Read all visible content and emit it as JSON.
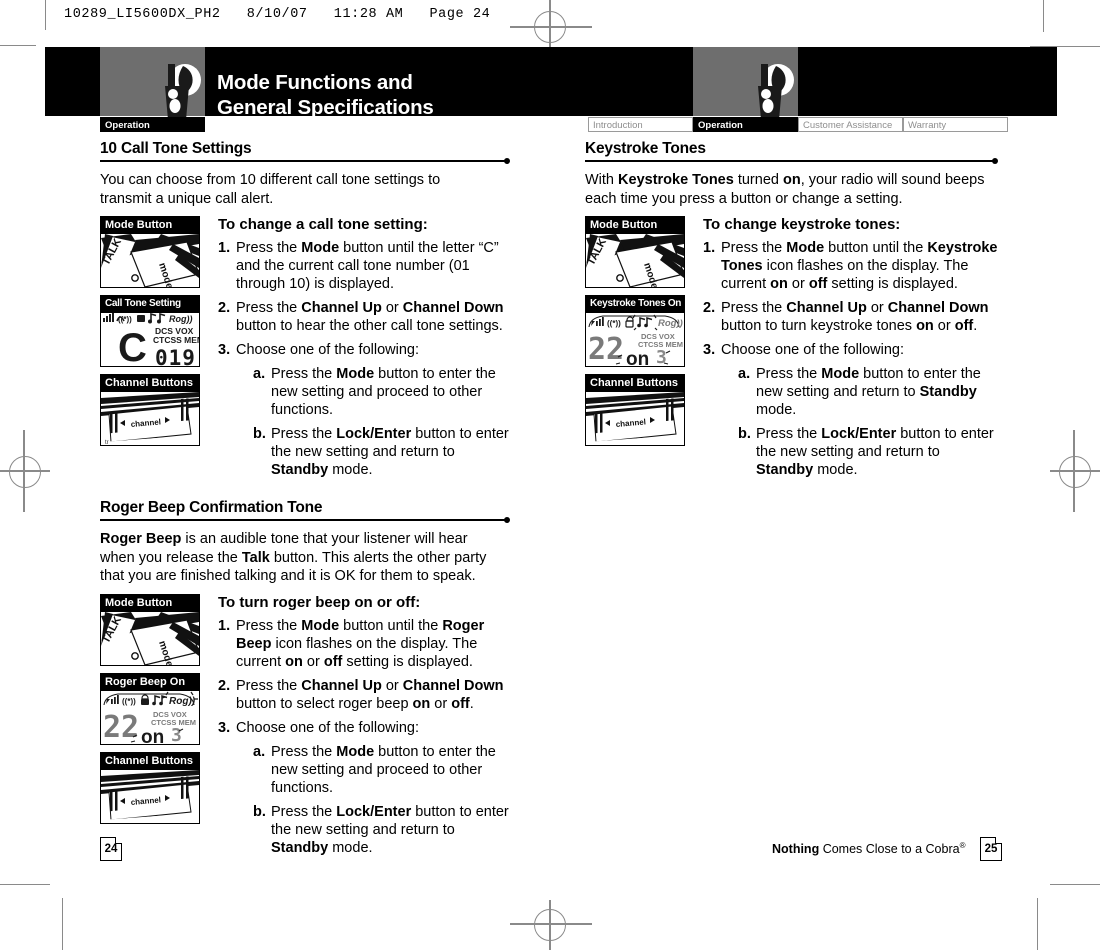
{
  "prepress": {
    "slug": "10289_LI5600DX_PH2   8/10/07   11:28 AM   Page 24"
  },
  "header": {
    "title_line1": "Mode Functions and",
    "title_line2": "General Specifications",
    "left_tab_label": "Operation",
    "icon_name": "two-way-radio-icon"
  },
  "tabs_right": [
    {
      "label": "Introduction",
      "active": false
    },
    {
      "label": "Operation",
      "active": true
    },
    {
      "label": "Customer Assistance",
      "active": false
    },
    {
      "label": "Warranty",
      "active": false
    }
  ],
  "left_column": {
    "sections": [
      {
        "heading": "10 Call Tone Settings",
        "intro": "You can choose from 10 different call tone settings to transmit a unique call alert.",
        "figures": [
          {
            "caption": "Mode Button",
            "art": "mode-button-photo"
          },
          {
            "caption": "Call Tone Setting",
            "art": "lcd-call-tone"
          },
          {
            "caption": "Channel Buttons",
            "art": "channel-buttons-photo"
          }
        ],
        "steps_heading": "To change a call tone setting:",
        "steps": [
          {
            "num": "1.",
            "text_html": "Press the <b>Mode</b> button until the letter “C” and the current call tone number (01 through 10) is displayed."
          },
          {
            "num": "2.",
            "text_html": "Press the <b>Channel Up</b> or <b>Channel Down</b> button to hear the other call tone settings."
          },
          {
            "num": "3.",
            "text_html": "Choose one of the following:",
            "sub": [
              {
                "num": "a.",
                "text_html": "Press the <b>Mode</b> button to enter the new setting and proceed to other functions."
              },
              {
                "num": "b.",
                "text_html": "Press the <b>Lock/Enter</b> button to enter the new setting and return to <b>Standby</b> mode."
              }
            ]
          }
        ]
      },
      {
        "heading": "Roger Beep Confirmation Tone",
        "intro_html": "<b>Roger Beep</b> is an audible tone that your listener will hear when you release the <b>Talk</b> button. This alerts the other party that you are finished talking and it is OK for them to speak.",
        "figures": [
          {
            "caption": "Mode Button",
            "art": "mode-button-photo"
          },
          {
            "caption": "Roger Beep On",
            "art": "lcd-roger-beep"
          },
          {
            "caption": "Channel Buttons",
            "art": "channel-buttons-photo"
          }
        ],
        "steps_heading": "To turn roger beep on or off:",
        "steps": [
          {
            "num": "1.",
            "text_html": "Press the <b>Mode</b> button until the <b>Roger Beep</b> icon flashes on the display. The current <b>on</b> or <b>off</b> setting is displayed."
          },
          {
            "num": "2.",
            "text_html": "Press the <b>Channel Up</b> or <b>Channel Down</b> button to select roger beep <b>on</b> or <b>off</b>."
          },
          {
            "num": "3.",
            "text_html": "Choose one of the following:",
            "sub": [
              {
                "num": "a.",
                "text_html": "Press the <b>Mode</b> button to enter the new setting and proceed to other functions."
              },
              {
                "num": "b.",
                "text_html": "Press the <b>Lock/Enter</b> button to enter the new setting and return to <b>Standby</b> mode."
              }
            ]
          }
        ]
      }
    ]
  },
  "right_column": {
    "sections": [
      {
        "heading": "Keystroke Tones",
        "intro_html": "With <b>Keystroke Tones</b> turned <b>on</b>, your radio will sound beeps each time you press a button or change a setting.",
        "figures": [
          {
            "caption": "Mode Button",
            "art": "mode-button-photo"
          },
          {
            "caption": "Keystroke Tones On",
            "art": "lcd-keystroke"
          },
          {
            "caption": "Channel Buttons",
            "art": "channel-buttons-photo"
          }
        ],
        "steps_heading": "To change keystroke tones:",
        "steps": [
          {
            "num": "1.",
            "text_html": "Press the <b>Mode</b> button until the <b>Keystroke Tones</b> icon flashes on the display. The current <b>on</b> or <b>off</b> setting is displayed."
          },
          {
            "num": "2.",
            "text_html": "Press the <b>Channel Up</b> or <b>Channel Down</b> button to turn keystroke tones <b>on</b> or <b>off</b>."
          },
          {
            "num": "3.",
            "text_html": "Choose one of the following:",
            "sub": [
              {
                "num": "a.",
                "text_html": "Press the <b>Mode</b> button to enter the new setting and return to <b>Standby</b> mode."
              },
              {
                "num": "b.",
                "text_html": "Press the <b>Lock/Enter</b> button to enter the new setting and return to <b>Standby</b> mode."
              }
            ]
          }
        ]
      }
    ]
  },
  "lcd_displays": {
    "call_tone": {
      "main_digits": "C 019",
      "indicators": [
        "DCS",
        "VOX",
        "CTCSS",
        "MEM"
      ],
      "top_icons": [
        "signal-bars-icon",
        "antenna-icon",
        "lock-icon",
        "note-icon",
        "rog-icon"
      ]
    },
    "roger_beep": {
      "channel": "22",
      "value": "on",
      "indicators": [
        "DCS",
        "VOX",
        "CTCSS",
        "MEM"
      ],
      "top_icons": [
        "signal-bars-icon",
        "antenna-icon",
        "lock-icon",
        "note-icon",
        "rog-icon"
      ],
      "flashing_icon": "rog-icon"
    },
    "keystroke_tones": {
      "channel": "22",
      "value": "on",
      "indicators": [
        "DCS",
        "VOX",
        "CTCSS",
        "MEM"
      ],
      "top_icons": [
        "signal-bars-icon",
        "antenna-icon",
        "lock-icon",
        "note-icon",
        "rog-icon"
      ],
      "flashing_icon": "note-icon"
    },
    "channel_button_label": "channel"
  },
  "photo_labels": {
    "mode": "mode",
    "talk": "TALK"
  },
  "footer": {
    "left_page": "24",
    "right_page": "25",
    "tagline_bold": "Nothing",
    "tagline_rest": " Comes Close to a Cobra",
    "tagline_sup": "®"
  },
  "colors": {
    "band": "#000000",
    "grey_box": "#6e6e6e",
    "mark": "#8a8a8a",
    "tab_inactive_text": "#8e8e8e"
  }
}
